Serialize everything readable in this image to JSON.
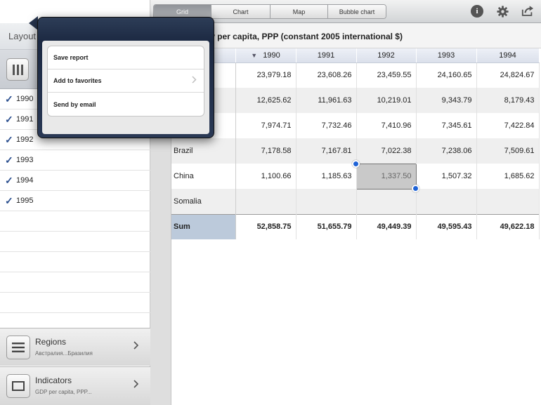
{
  "sidebar": {
    "title": "Layout",
    "years": [
      "1990",
      "1991",
      "1992",
      "1993",
      "1994",
      "1995"
    ],
    "check_glyph": "✓",
    "regions": {
      "title": "Regions",
      "subtitle": "Австралия...Бразилия"
    },
    "indicators": {
      "title": "Indicators",
      "subtitle": "GDP per capita, PPP..."
    }
  },
  "toolbar": {
    "tabs": [
      {
        "label": "Grid",
        "active": true
      },
      {
        "label": "Chart",
        "active": false
      },
      {
        "label": "Map",
        "active": false
      },
      {
        "label": "Bubble chart",
        "active": false
      }
    ],
    "info_glyph": "i",
    "icons": [
      "info-icon",
      "gear-icon",
      "share-icon"
    ]
  },
  "report": {
    "title": "GDP per capita, PPP (constant 2005 international $)"
  },
  "grid": {
    "columns": [
      "1990",
      "1991",
      "1992",
      "1993",
      "1994"
    ],
    "rows": [
      {
        "name": "",
        "values": [
          "23,979.18",
          "23,608.26",
          "23,459.55",
          "24,160.65",
          "24,824.67"
        ]
      },
      {
        "name": "",
        "values": [
          "12,625.62",
          "11,961.63",
          "10,219.01",
          "9,343.79",
          "8,179.43"
        ]
      },
      {
        "name": "",
        "values": [
          "7,974.71",
          "7,732.46",
          "7,410.96",
          "7,345.61",
          "7,422.84"
        ]
      },
      {
        "name": "Brazil",
        "values": [
          "7,178.58",
          "7,167.81",
          "7,022.38",
          "7,238.06",
          "7,509.61"
        ]
      },
      {
        "name": "China",
        "values": [
          "1,100.66",
          "1,185.63",
          "1,337.50",
          "1,507.32",
          "1,685.62"
        ]
      },
      {
        "name": "Somalia",
        "values": [
          "",
          "",
          "",
          "",
          ""
        ]
      }
    ],
    "sum": {
      "name": "Sum",
      "values": [
        "52,858.75",
        "51,655.79",
        "49,449.39",
        "49,595.43",
        "49,622.18"
      ]
    },
    "selected_cell": {
      "row": 4,
      "col": 2
    }
  },
  "popover": {
    "items": [
      {
        "label": "Save report",
        "has_submenu": false
      },
      {
        "label": "Add to favorites",
        "has_submenu": true
      },
      {
        "label": "Send by email",
        "has_submenu": false
      }
    ]
  },
  "colors": {
    "accent": "#2b4f8f",
    "selection_handle": "#1f63d6",
    "sum_header": "#bccadb",
    "popover_frame": "#1c2942"
  }
}
